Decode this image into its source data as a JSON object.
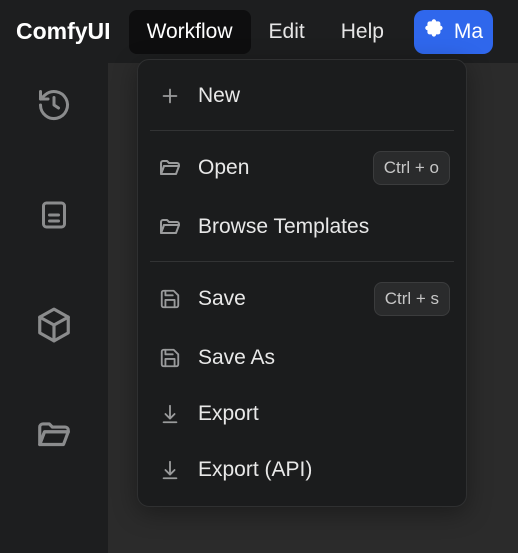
{
  "app": {
    "title": "ComfyUI"
  },
  "menubar": {
    "workflow": "Workflow",
    "edit": "Edit",
    "help": "Help",
    "manager": "Ma"
  },
  "dropdown": {
    "new": "New",
    "open": "Open",
    "open_shortcut": "Ctrl + o",
    "browse_templates": "Browse Templates",
    "save": "Save",
    "save_shortcut": "Ctrl + s",
    "save_as": "Save As",
    "export": "Export",
    "export_api": "Export (API)"
  }
}
